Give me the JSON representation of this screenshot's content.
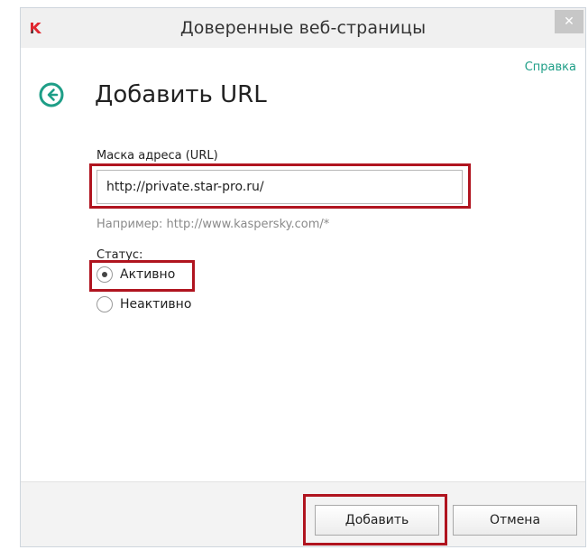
{
  "window": {
    "title": "Доверенные веб-страницы",
    "close_glyph": "✕",
    "app_icon": "kaspersky-logo-icon"
  },
  "header": {
    "help_link": "Справка",
    "back_icon": "back-arrow-icon",
    "title": "Добавить URL"
  },
  "form": {
    "url_label": "Маска адреса (URL)",
    "url_value": "http://private.star-pro.ru/",
    "url_hint": "Например: http://www.kaspersky.com/*",
    "status_label": "Статус:",
    "status_options": [
      {
        "label": "Активно",
        "selected": true
      },
      {
        "label": "Неактивно",
        "selected": false
      }
    ]
  },
  "footer": {
    "add_button": "Добавить",
    "cancel_button": "Отмена"
  },
  "colors": {
    "accent": "#1e9e87",
    "highlight": "#b0141f",
    "logo": "#e0262f"
  }
}
